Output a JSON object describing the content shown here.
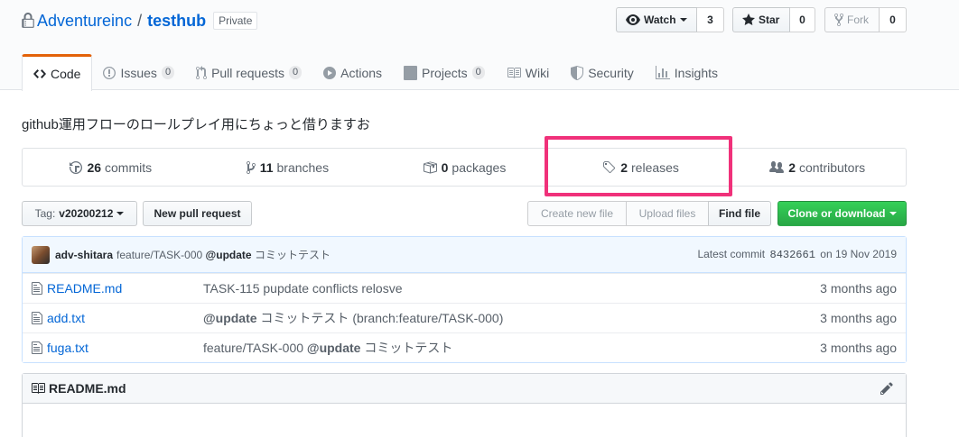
{
  "repo": {
    "owner": "Adventureinc",
    "separator": "/",
    "name": "testhub",
    "visibility": "Private"
  },
  "actions": {
    "watch_label": "Watch",
    "watch_count": "3",
    "star_label": "Star",
    "star_count": "0",
    "fork_label": "Fork",
    "fork_count": "0"
  },
  "tabs": [
    {
      "label": "Code",
      "icon": "code-icon",
      "counter": null,
      "selected": true
    },
    {
      "label": "Issues",
      "icon": "issue-icon",
      "counter": "0"
    },
    {
      "label": "Pull requests",
      "icon": "pull-request-icon",
      "counter": "0"
    },
    {
      "label": "Actions",
      "icon": "play-icon",
      "counter": null
    },
    {
      "label": "Projects",
      "icon": "project-icon",
      "counter": "0"
    },
    {
      "label": "Wiki",
      "icon": "book-icon",
      "counter": null
    },
    {
      "label": "Security",
      "icon": "shield-icon",
      "counter": null
    },
    {
      "label": "Insights",
      "icon": "graph-icon",
      "counter": null
    }
  ],
  "description": "github運用フローのロールプレイ用にちょっと借りますお",
  "summary": {
    "commits_count": "26",
    "commits_label": "commits",
    "branches_count": "11",
    "branches_label": "branches",
    "packages_count": "0",
    "packages_label": "packages",
    "releases_count": "2",
    "releases_label": "releases",
    "contributors_count": "2",
    "contributors_label": "contributors"
  },
  "toolbar": {
    "tag_prefix": "Tag:",
    "tag_value": "v20200212",
    "new_pr": "New pull request",
    "create_file": "Create new file",
    "upload_files": "Upload files",
    "find_file": "Find file",
    "clone": "Clone or download"
  },
  "latest_commit": {
    "author": "adv-shitara",
    "message_prefix": "feature/TASK-000",
    "mention": "@update",
    "message_suffix": "コミットテスト",
    "label": "Latest commit",
    "sha": "8432661",
    "date": "on 19 Nov 2019"
  },
  "files": [
    {
      "name": "README.md",
      "msg_pre": "TASK-115 pupdate conflicts relosve",
      "mention": "",
      "msg_post": "",
      "age": "3 months ago"
    },
    {
      "name": "add.txt",
      "msg_pre": "",
      "mention": "@update",
      "msg_post": " コミットテスト (branch:feature/TASK-000)",
      "age": "3 months ago"
    },
    {
      "name": "fuga.txt",
      "msg_pre": "feature/TASK-000 ",
      "mention": "@update",
      "msg_post": " コミットテスト",
      "age": "3 months ago"
    }
  ],
  "readme": {
    "title": "README.md"
  },
  "colors": {
    "link": "#0366d6",
    "highlight": "#f0317a",
    "green": "#28a745",
    "tab_accent": "#e36209"
  }
}
